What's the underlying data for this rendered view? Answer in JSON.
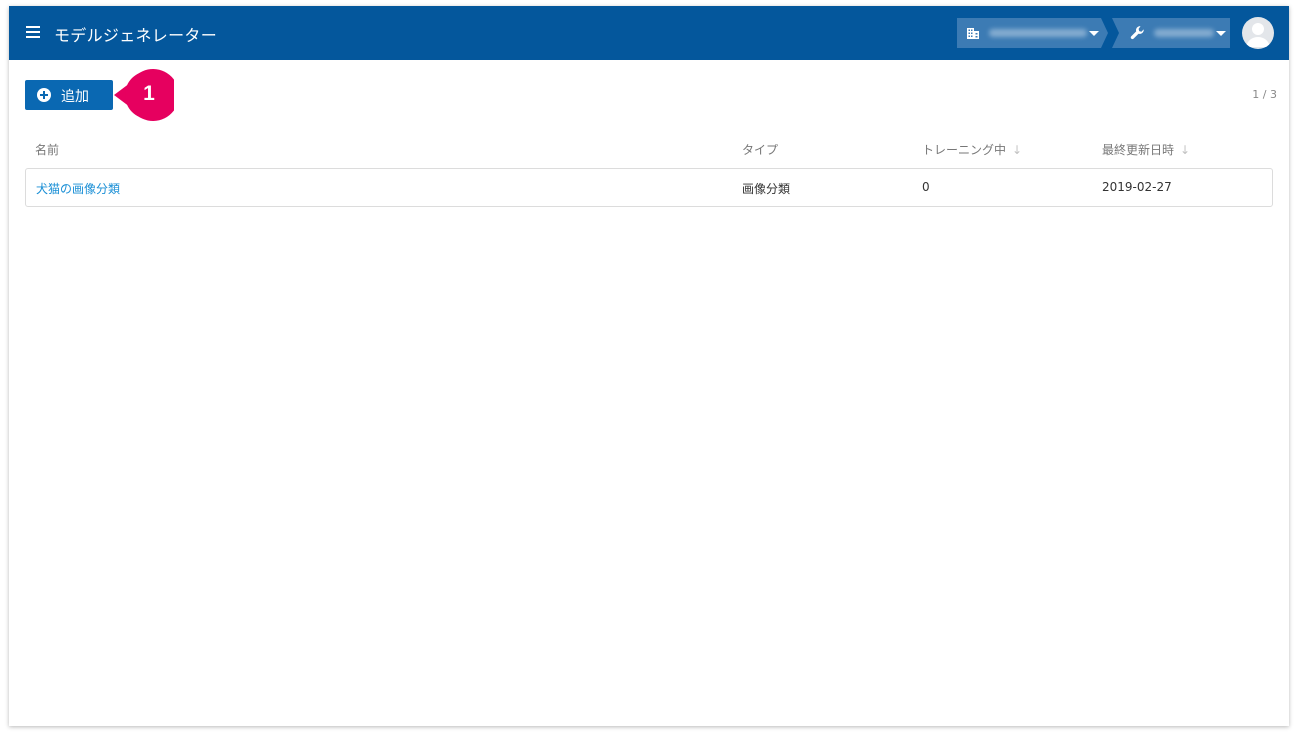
{
  "header": {
    "title": "モデルジェネレーター",
    "background": "#04579c"
  },
  "toolbar": {
    "add_label": "追加",
    "callout_number": "1",
    "callout_color": "#e6005f",
    "pager": "1 / 3"
  },
  "table": {
    "columns": [
      {
        "label": "名前",
        "sortable": false
      },
      {
        "label": "タイプ",
        "sortable": false
      },
      {
        "label": "トレーニング中",
        "sortable": true
      },
      {
        "label": "最終更新日時",
        "sortable": true
      }
    ],
    "rows": [
      {
        "name": "犬猫の画像分類",
        "type": "画像分類",
        "training": "0",
        "updated": "2019-02-27"
      }
    ]
  },
  "icons": {
    "menu": "menu-icon",
    "org": "building-icon",
    "role": "wrench-icon",
    "sort": "arrow-down-icon",
    "avatar": "user-avatar-icon"
  }
}
